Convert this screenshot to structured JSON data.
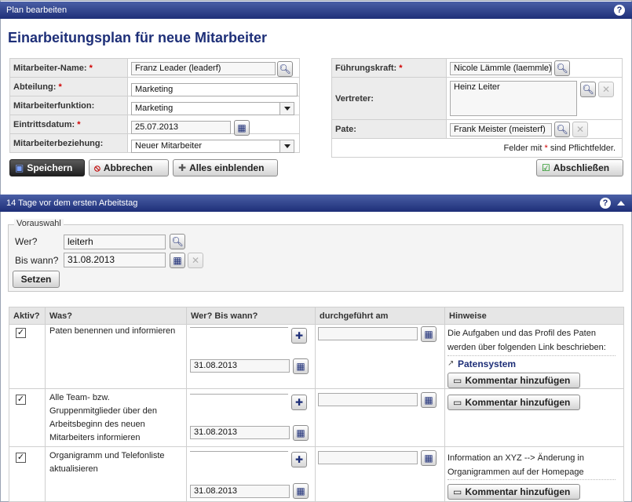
{
  "header": {
    "title": "Plan bearbeiten",
    "help": "?"
  },
  "page_title": "Einarbeitungsplan für neue Mitarbeiter",
  "form_left": {
    "employee_label": "Mitarbeiter-Name:",
    "employee_value": "Franz Leader (leaderf)",
    "department_label": "Abteilung:",
    "department_value": "Marketing",
    "function_label": "Mitarbeiterfunktion:",
    "function_value": "Marketing",
    "entry_label": "Eintrittsdatum:",
    "entry_value": "25.07.2013",
    "relation_label": "Mitarbeiterbeziehung:",
    "relation_value": "Neuer Mitarbeiter"
  },
  "form_right": {
    "manager_label": "Führungskraft:",
    "manager_value": "Nicole Lämmle (laemmle)",
    "deputy_label": "Vertreter:",
    "deputy_value": "Heinz Leiter",
    "mentor_label": "Pate:",
    "mentor_value": "Frank Meister (meisterf)",
    "required_prefix": "Felder mit",
    "required_star": "*",
    "required_suffix": "sind Pflichtfelder."
  },
  "required_marker": "*",
  "buttons": {
    "save": "Speichern",
    "cancel": "Abbrechen",
    "show_all": "Alles einblenden",
    "finish": "Abschließen"
  },
  "section": {
    "title": "14 Tage vor dem ersten Arbeitstag",
    "help": "?"
  },
  "preselect": {
    "legend": "Vorauswahl",
    "who_label": "Wer?",
    "who_value": "leiterh",
    "until_label": "Bis wann?",
    "until_value": "31.08.2013",
    "set_button": "Setzen"
  },
  "table": {
    "headers": [
      "Aktiv?",
      "Was?",
      "Wer? Bis wann?",
      "durchgeführt am",
      "Hinweise"
    ],
    "rows": [
      {
        "active": true,
        "task_lines": [
          "Paten benennen und informieren"
        ],
        "who": "",
        "date": "31.08.2013",
        "done": "",
        "hint_lines": [
          "Die Aufgaben und das Profil des Paten",
          "werden über folgenden Link beschrieben:"
        ],
        "link": "Patensystem",
        "comment_button": "Kommentar hinzufügen"
      },
      {
        "active": true,
        "task_lines": [
          "Alle Team- bzw.",
          "Gruppenmitglieder über den",
          "Arbeitsbeginn des neuen",
          "Mitarbeiters informieren"
        ],
        "who": "",
        "date": "31.08.2013",
        "done": "",
        "hint_lines": [],
        "link": "",
        "comment_button": "Kommentar hinzufügen"
      },
      {
        "active": true,
        "task_lines": [
          "Organigramm und Telefonliste",
          "aktualisieren"
        ],
        "who": "",
        "date": "31.08.2013",
        "done": "",
        "hint_lines": [
          "Information an XYZ --> Änderung in",
          "Organigrammen auf der Homepage"
        ],
        "link": "",
        "comment_button": "Kommentar hinzufügen"
      }
    ]
  },
  "colors": {
    "accent": "#1e2f78",
    "required": "#d00000"
  },
  "icons": [
    "search-icon",
    "calendar-icon",
    "clear-icon",
    "plus-icon",
    "save-icon",
    "cancel-icon",
    "expand-icon",
    "check-icon",
    "comment-icon",
    "link-icon",
    "help-icon",
    "collapse-icon"
  ]
}
